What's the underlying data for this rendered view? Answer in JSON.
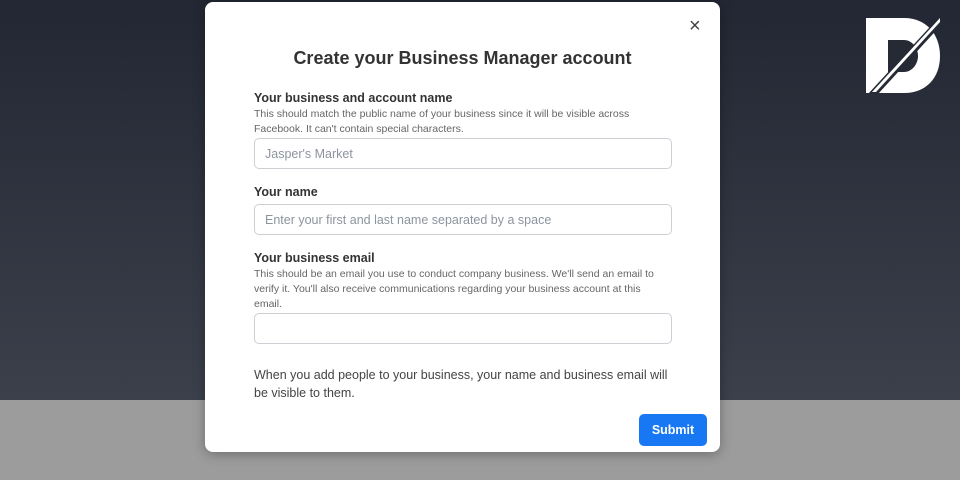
{
  "dialog": {
    "title": "Create your Business Manager account",
    "close_icon": "×",
    "fields": [
      {
        "label": "Your business and account name",
        "help": "This should match the public name of your business since it will be visible across Facebook. It can't contain special characters.",
        "placeholder": "Jasper's Market",
        "value": ""
      },
      {
        "label": "Your name",
        "placeholder": "Enter your first and last name separated by a space",
        "value": ""
      },
      {
        "label": "Your business email",
        "help": "This should be an email you use to conduct company business. We'll send an email to verify it. You'll also receive communications regarding your business account at this email.",
        "placeholder": "",
        "value": ""
      }
    ],
    "note": "When you add people to your business, your name and business email will be visible to them.",
    "submit_label": "Submit"
  },
  "colors": {
    "accent": "#1877f2"
  }
}
